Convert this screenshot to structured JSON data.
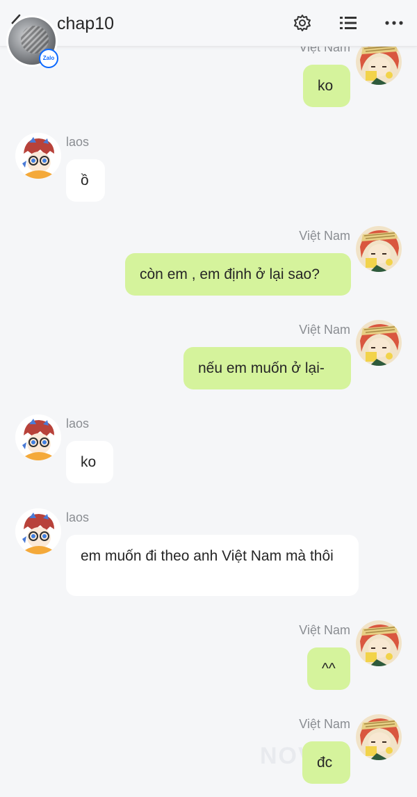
{
  "header": {
    "title": "chap10",
    "badge": "Zalo"
  },
  "messages": [
    {
      "sender": "Việt Nam",
      "text": "ko"
    },
    {
      "sender": "laos",
      "text": "ồ"
    },
    {
      "sender": "Việt Nam",
      "text": "còn em , em định ở lại sao?"
    },
    {
      "sender": "Việt Nam",
      "text": "nếu em muốn ở lại-"
    },
    {
      "sender": "laos",
      "text": "ko"
    },
    {
      "sender": "laos",
      "text": "em muốn đi theo anh Việt Nam mà thôi"
    },
    {
      "sender": "Việt Nam",
      "text": "^^"
    },
    {
      "sender": "Việt Nam",
      "text": "đc"
    }
  ],
  "watermark": "NOVEL",
  "colors": {
    "outgoing_bubble": "#d5f39c",
    "incoming_bubble": "#ffffff",
    "background": "#f5f6f8"
  }
}
